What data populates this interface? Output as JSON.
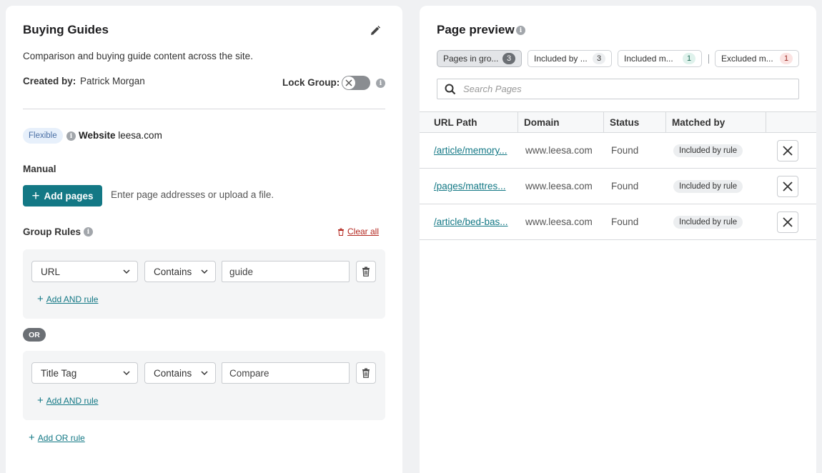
{
  "group": {
    "title": "Buying Guides",
    "description": "Comparison and buying guide content across the site.",
    "created_by_label": "Created by:",
    "created_by_value": "Patrick Morgan",
    "lock_label": "Lock Group:",
    "lock_on": false
  },
  "scope": {
    "badge": "Flexible",
    "website_label": "Website",
    "website_value": "leesa.com"
  },
  "manual": {
    "label": "Manual",
    "add_pages_label": "Add pages",
    "hint": "Enter page addresses or upload a file."
  },
  "rules": {
    "label": "Group Rules",
    "clear_all": "Clear all",
    "or_label": "OR",
    "add_and_label": "Add AND rule",
    "add_or_label": "Add OR rule",
    "groups": [
      {
        "field": "URL",
        "operator": "Contains",
        "value": "guide"
      },
      {
        "field": "Title Tag",
        "operator": "Contains",
        "value": "Compare"
      }
    ]
  },
  "preview": {
    "title": "Page preview",
    "filters": [
      {
        "label": "Pages in gro...",
        "count": "3"
      },
      {
        "label": "Included by ...",
        "count": "3"
      },
      {
        "label": "Included m...",
        "count": "1"
      },
      {
        "label": "Excluded m...",
        "count": "1"
      }
    ],
    "search_placeholder": "Search Pages",
    "columns": [
      "URL Path",
      "Domain",
      "Status",
      "Matched by"
    ],
    "rows": [
      {
        "path": "/article/memory...",
        "domain": "www.leesa.com",
        "status": "Found",
        "matched_by": "Included by rule"
      },
      {
        "path": "/pages/mattres...",
        "domain": "www.leesa.com",
        "status": "Found",
        "matched_by": "Included by rule"
      },
      {
        "path": "/article/bed-bas...",
        "domain": "www.leesa.com",
        "status": "Found",
        "matched_by": "Included by rule"
      }
    ]
  },
  "colors": {
    "accent": "#137885",
    "danger": "#b3261e"
  }
}
